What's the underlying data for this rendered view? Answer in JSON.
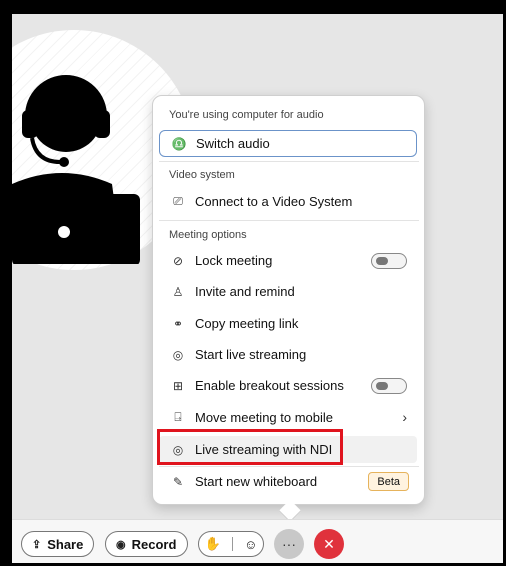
{
  "menu": {
    "audio_section": "You're using computer for audio",
    "switch_audio": "Switch audio",
    "video_section": "Video system",
    "connect_video": "Connect to a Video System",
    "options_section": "Meeting options",
    "lock_meeting": "Lock meeting",
    "invite": "Invite and remind",
    "copy_link": "Copy meeting link",
    "start_live": "Start live streaming",
    "breakout": "Enable breakout sessions",
    "move_mobile": "Move meeting to mobile",
    "ndi": "Live streaming with NDI",
    "whiteboard": "Start new whiteboard",
    "beta": "Beta",
    "chevron": "›"
  },
  "toolbar": {
    "share": "Share",
    "record": "Record",
    "more": "···",
    "end": "✕"
  },
  "icons": {
    "mic": "♎",
    "screen": "⎚",
    "lock": "⊘",
    "person_add": "♙",
    "link": "⚭",
    "stream": "◎",
    "breakout": "⊞",
    "mobile": "⍈",
    "pen": "✎"
  },
  "colors": {
    "end_red": "#e0323c",
    "highlight_red": "#e0141e",
    "beta_bg": "#fff3e0"
  },
  "toggles": {
    "lock_meeting": "off",
    "breakout_sessions": "off"
  }
}
